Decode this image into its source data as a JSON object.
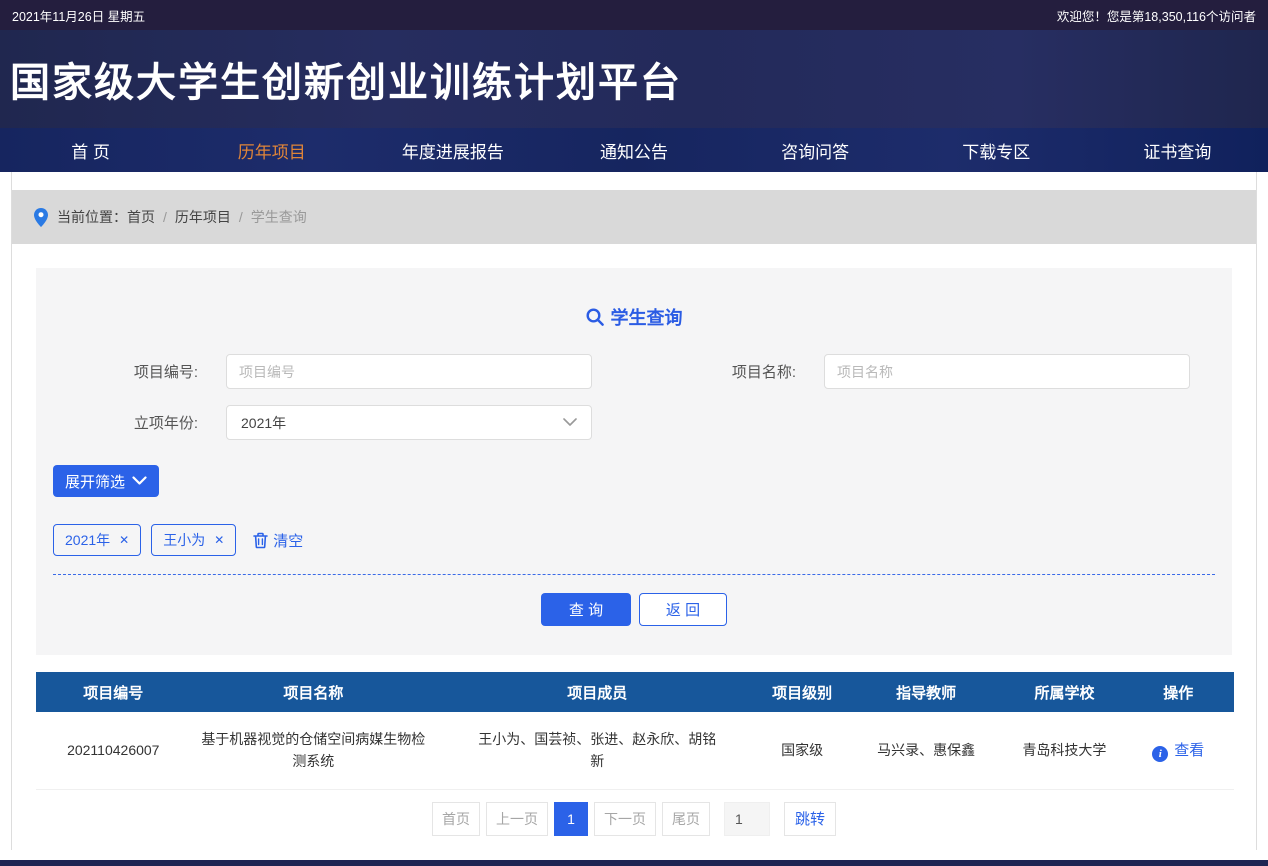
{
  "topbar": {
    "date": "2021年11月26日 星期五",
    "welcome": "欢迎您！您是第18,350,116个访问者"
  },
  "header": {
    "title": "国家级大学生创新创业训练计划平台"
  },
  "nav": {
    "items": [
      {
        "label": "首 页",
        "active": false
      },
      {
        "label": "历年项目",
        "active": true
      },
      {
        "label": "年度进展报告",
        "active": false
      },
      {
        "label": "通知公告",
        "active": false
      },
      {
        "label": "咨询问答",
        "active": false
      },
      {
        "label": "下载专区",
        "active": false
      },
      {
        "label": "证书查询",
        "active": false
      }
    ]
  },
  "breadcrumb": {
    "label": "当前位置：",
    "items": [
      "首页",
      "历年项目",
      "学生查询"
    ],
    "separator": "/"
  },
  "search": {
    "title": "学生查询",
    "fields": {
      "project_code": {
        "label": "项目编号:",
        "placeholder": "项目编号"
      },
      "project_name": {
        "label": "项目名称:",
        "placeholder": "项目名称"
      },
      "year": {
        "label": "立项年份:",
        "value": "2021年"
      }
    },
    "expand_filter": "展开筛选",
    "tags": [
      "2021年",
      "王小为"
    ],
    "clear": "清空",
    "query_button": "查 询",
    "back_button": "返 回"
  },
  "table": {
    "headers": [
      "项目编号",
      "项目名称",
      "项目成员",
      "项目级别",
      "指导教师",
      "所属学校",
      "操作"
    ],
    "rows": [
      {
        "code": "202110426007",
        "name": "基于机器视觉的仓储空间病媒生物检测系统",
        "members": "王小为、国芸祯、张进、赵永欣、胡铭新",
        "level": "国家级",
        "teachers": "马兴录、惠保鑫",
        "school": "青岛科技大学",
        "action": "查看"
      }
    ]
  },
  "pagination": {
    "first": "首页",
    "prev": "上一页",
    "current": "1",
    "next": "下一页",
    "last": "尾页",
    "input_value": "1",
    "jump": "跳转"
  },
  "icons": {
    "close": "✕",
    "info": "i"
  },
  "colors": {
    "accent_blue": "#2b62e8",
    "title_blue": "#2b5ce4",
    "nav_active_orange": "#e08538",
    "table_header_blue": "#17579b",
    "topbar_bg": "#241e3e",
    "header_bg": "#232a5a",
    "nav_bg": "#1a2a64",
    "breadcrumb_bg": "#d9d9d9",
    "card_bg": "#f5f5f6",
    "footer_bg": "#1e2553"
  }
}
